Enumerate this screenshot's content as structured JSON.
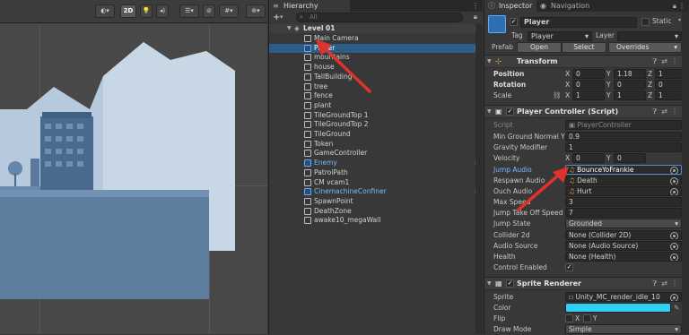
{
  "scene": {
    "toolbar": {
      "mode_2d": "2D"
    }
  },
  "hierarchy": {
    "tab_label": "Hierarchy",
    "add_label": "+",
    "search_placeholder": "All",
    "scene_name": "Level 01",
    "items": [
      {
        "label": "Main Camera",
        "type": "object"
      },
      {
        "label": "Player",
        "type": "prefab-selected"
      },
      {
        "label": "mountains",
        "type": "object"
      },
      {
        "label": "house",
        "type": "object"
      },
      {
        "label": "TallBuilding",
        "type": "object"
      },
      {
        "label": "tree",
        "type": "object"
      },
      {
        "label": "fence",
        "type": "object"
      },
      {
        "label": "plant",
        "type": "object"
      },
      {
        "label": "TileGroundTop 1",
        "type": "object"
      },
      {
        "label": "TileGroundTop 2",
        "type": "object"
      },
      {
        "label": "TileGround",
        "type": "object"
      },
      {
        "label": "Token",
        "type": "object"
      },
      {
        "label": "GameController",
        "type": "object"
      },
      {
        "label": "Enemy",
        "type": "prefab"
      },
      {
        "label": "PatrolPath",
        "type": "object"
      },
      {
        "label": "CM vcam1",
        "type": "object"
      },
      {
        "label": "CinemachineConfiner",
        "type": "prefab"
      },
      {
        "label": "SpawnPoint",
        "type": "object"
      },
      {
        "label": "DeathZone",
        "type": "object"
      },
      {
        "label": "awake10_megaWall",
        "type": "object"
      }
    ]
  },
  "inspector": {
    "tabs": [
      "Inspector",
      "Navigation"
    ],
    "object_name": "Player",
    "static_label": "Static",
    "tag_label": "Tag",
    "tag_value": "Player",
    "layer_label": "Layer",
    "prefab_label": "Prefab",
    "open_label": "Open",
    "select_label": "Select",
    "overrides_label": "Overrides",
    "transform": {
      "title": "Transform",
      "position_label": "Position",
      "rotation_label": "Rotation",
      "scale_label": "Scale",
      "position": {
        "x": "0",
        "y": "1.18",
        "z": "1"
      },
      "rotation": {
        "x": "0",
        "y": "0",
        "z": "0"
      },
      "scale": {
        "x": "1",
        "y": "1",
        "z": "1"
      }
    },
    "player_controller": {
      "title": "Player Controller (Script)",
      "script_label": "Script",
      "script_value": "PlayerController",
      "fields": [
        {
          "label": "Min Ground Normal Y",
          "value": "0.9"
        },
        {
          "label": "Gravity Modifier",
          "value": "1"
        }
      ],
      "velocity_label": "Velocity",
      "velocity": {
        "x": "0",
        "y": "0"
      },
      "jump_audio_label": "Jump Audio",
      "jump_audio_value": "BounceYoFrankie",
      "respawn_audio_label": "Respawn Audio",
      "respawn_audio_value": "Death",
      "ouch_audio_label": "Ouch Audio",
      "ouch_audio_value": "Hurt",
      "max_speed_label": "Max Speed",
      "max_speed_value": "3",
      "jump_take_off_label": "Jump Take Off Speed",
      "jump_take_off_value": "7",
      "jump_state_label": "Jump State",
      "jump_state_value": "Grounded",
      "collider_label": "Collider 2d",
      "collider_value": "None (Collider 2D)",
      "audio_source_label": "Audio Source",
      "audio_source_value": "None (Audio Source)",
      "health_label": "Health",
      "health_value": "None (Health)",
      "control_enabled_label": "Control Enabled"
    },
    "sprite_renderer": {
      "title": "Sprite Renderer",
      "sprite_label": "Sprite",
      "sprite_value": "Unity_MC_render_idle_10",
      "color_label": "Color",
      "color_value": "#31d0f2",
      "flip_label": "Flip",
      "flip_x": "X",
      "flip_y": "Y",
      "draw_mode_label": "Draw Mode",
      "draw_mode_value": "Simple"
    }
  },
  "colors": {
    "selection": "#2c5d87",
    "prefab_text": "#7eb6ff",
    "annotation_arrow": "#e0322c"
  }
}
